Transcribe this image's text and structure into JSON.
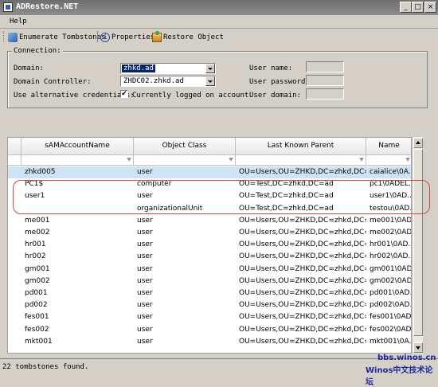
{
  "window": {
    "title": "ADRestore.NET"
  },
  "menu": {
    "help": "Help"
  },
  "toolbar": {
    "enumerate": "Enumerate Tombstones",
    "properties": "Properties",
    "restore": "Restore Object"
  },
  "connection": {
    "legend": "Connection:",
    "domain_label": "Domain:",
    "domain_value": "zhkd.ad",
    "dc_label": "Domain Controller:",
    "dc_value": "ZHDC02.zhkd.ad",
    "alt_label": "Use alternative credentials:",
    "logged_on_label": "Currently logged on account",
    "logged_on_checked": true,
    "username_label": "User name:",
    "password_label": "User password:",
    "userdomain_label": "User domain:"
  },
  "grid": {
    "columns": [
      "sAMAccountName",
      "Object Class",
      "Last Known Parent",
      "Name"
    ],
    "rows": [
      [
        "zhkd005",
        "user",
        "OU=Users,OU=ZHKD,DC=zhkd,DC=ad",
        "caialice\\0A..."
      ],
      [
        "PC1$",
        "computer",
        "OU=Test,DC=zhkd,DC=ad",
        "pc1\\0ADEL..."
      ],
      [
        "user1",
        "user",
        "OU=Test,DC=zhkd,DC=ad",
        "user1\\0AD..."
      ],
      [
        "",
        "organizationalUnit",
        "OU=Test,DC=zhkd,DC=ad",
        "testou\\0AD..."
      ],
      [
        "me001",
        "user",
        "OU=Users,OU=ZHKD,DC=zhkd,DC=ad",
        "me001\\0AD..."
      ],
      [
        "me002",
        "user",
        "OU=Users,OU=ZHKD,DC=zhkd,DC=ad",
        "me002\\0AD..."
      ],
      [
        "hr001",
        "user",
        "OU=Users,OU=ZHKD,DC=zhkd,DC=ad",
        "hr001\\0AD..."
      ],
      [
        "hr002",
        "user",
        "OU=Users,OU=ZHKD,DC=zhkd,DC=ad",
        "hr002\\0AD..."
      ],
      [
        "gm001",
        "user",
        "OU=Users,OU=ZHKD,DC=zhkd,DC=ad",
        "gm001\\0AD..."
      ],
      [
        "gm002",
        "user",
        "OU=Users,OU=ZHKD,DC=zhkd,DC=ad",
        "gm002\\0AD..."
      ],
      [
        "pd001",
        "user",
        "OU=Users,OU=ZHKD,DC=zhkd,DC=ad",
        "pd001\\0AD..."
      ],
      [
        "pd002",
        "user",
        "OU=Users,OU=ZHKD,DC=zhkd,DC=ad",
        "pd002\\0AD..."
      ],
      [
        "fes001",
        "user",
        "OU=Users,OU=ZHKD,DC=zhkd,DC=ad",
        "fes001\\0AD..."
      ],
      [
        "fes002",
        "user",
        "OU=Users,OU=ZHKD,DC=zhkd,DC=ad",
        "fes002\\0AD..."
      ],
      [
        "mkt001",
        "user",
        "OU=Users,OU=ZHKD,DC=zhkd,DC=ad",
        "mkt001\\0A..."
      ]
    ]
  },
  "status": {
    "text": "22 tombstones found."
  },
  "watermark": {
    "line1": "bbs.winos.cn",
    "line2": "Winos中文技术论坛"
  }
}
